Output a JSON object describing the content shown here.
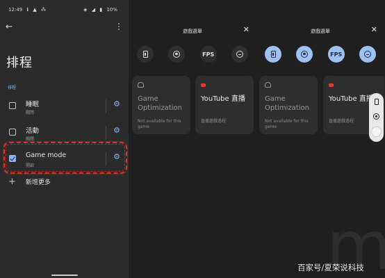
{
  "status_bar": {
    "time": "12:49",
    "left_icons": [
      "ℹ",
      "▲",
      "⁂"
    ],
    "battery": "10%"
  },
  "settings": {
    "title": "排程",
    "section_label": "排程",
    "rows": [
      {
        "name": "睡眠",
        "status": "關閉",
        "checked": false
      },
      {
        "name": "活動",
        "status": "關閉",
        "checked": false
      },
      {
        "name": "Game mode",
        "status": "開啟",
        "checked": true
      }
    ],
    "add_more": "新增更多"
  },
  "dashboard": {
    "title": "遊戲選單",
    "fps_label": "FPS",
    "tiles": {
      "optimization_title": "Game Optimization",
      "optimization_sub": "Not available for this game",
      "youtube_title": "YouTube 直播",
      "youtube_sub": "直播遊戲過程"
    }
  },
  "watermark": "百家号/夏荣说科技",
  "watermark_logo": "m"
}
